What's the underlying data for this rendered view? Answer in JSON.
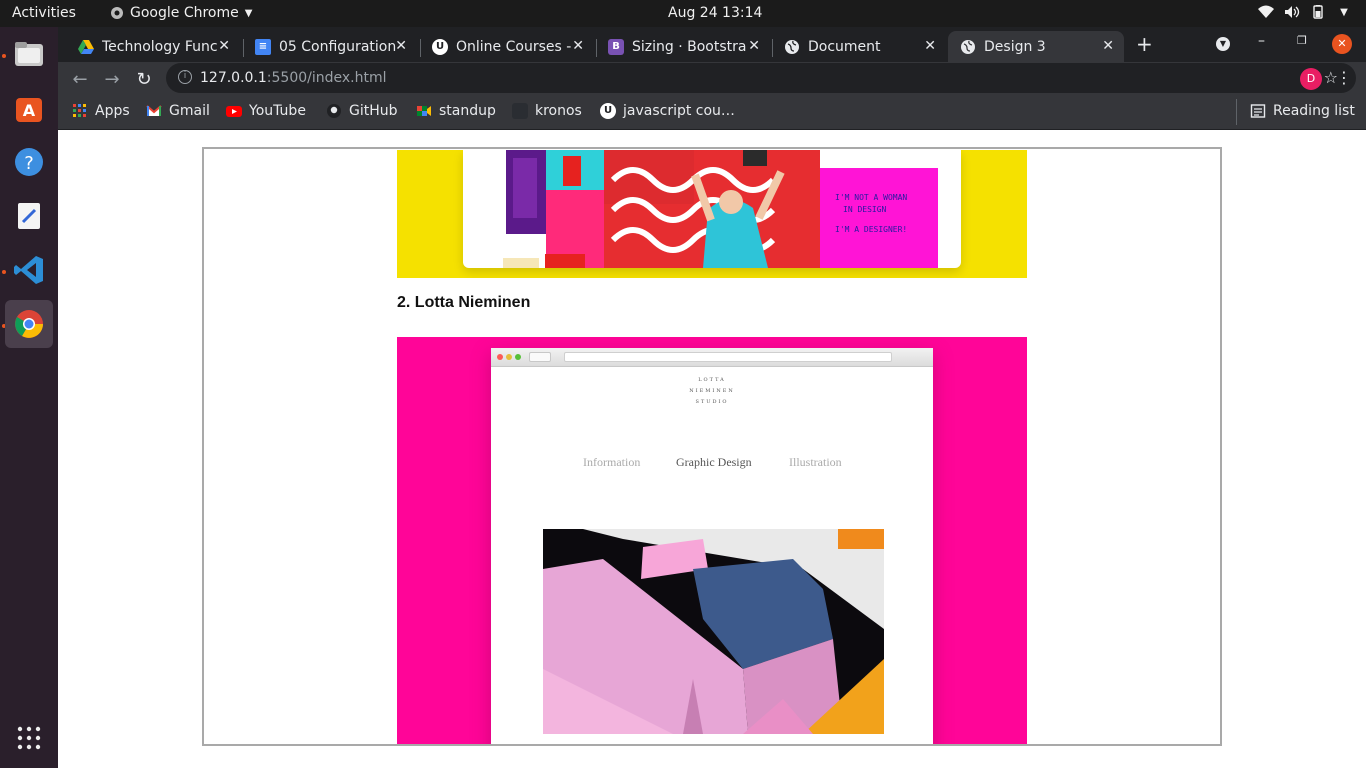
{
  "system": {
    "activities": "Activities",
    "app_name": "Google Chrome",
    "clock": "Aug 24  13:14"
  },
  "tabs": [
    {
      "title": "Technology Func",
      "favicon": "google-drive-icon",
      "color": "#34a853"
    },
    {
      "title": "05 Configuration",
      "favicon": "google-docs-icon",
      "color": "#4285f4"
    },
    {
      "title": "Online Courses -",
      "favicon": "udemy-icon",
      "color": "#ffffff"
    },
    {
      "title": "Sizing · Bootstra",
      "favicon": "bootstrap-icon",
      "color": "#7952b3"
    },
    {
      "title": "Document",
      "favicon": "globe-icon",
      "color": "#e8eaed"
    },
    {
      "title": "Design 3",
      "favicon": "globe-icon",
      "color": "#e8eaed"
    }
  ],
  "toolbar": {
    "url_host": "127.0.0.1",
    "url_rest": ":5500/index.html",
    "profile_initial": "D"
  },
  "bookmarks": {
    "items": [
      {
        "label": "Apps",
        "icon": "apps-grid-icon"
      },
      {
        "label": "Gmail",
        "icon": "gmail-icon"
      },
      {
        "label": "YouTube",
        "icon": "youtube-icon"
      },
      {
        "label": "GitHub",
        "icon": "github-icon"
      },
      {
        "label": "standup",
        "icon": "meet-icon"
      },
      {
        "label": "kronos",
        "icon": "kronos-icon"
      },
      {
        "label": "javascript cou…",
        "icon": "udemy-icon"
      }
    ],
    "reading_list": "Reading list"
  },
  "page": {
    "heading": "2. Lotta Nieminen",
    "mock_site": {
      "studio_lines": [
        "LOTTA",
        "NIEMINEN",
        "STUDIO"
      ],
      "nav": [
        "Information",
        "Graphic Design",
        "Illustration"
      ]
    },
    "colors": {
      "image1_bg": "#f5e100",
      "image2_bg": "#ff0598"
    }
  }
}
